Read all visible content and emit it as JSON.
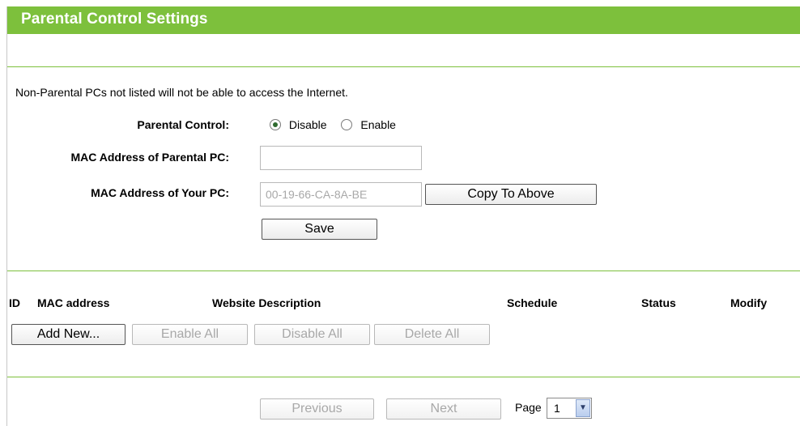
{
  "header": {
    "title": "Parental Control Settings"
  },
  "intro_text": "Non-Parental PCs not listed will not be able to access the Internet.",
  "form": {
    "parental_control_label": "Parental Control:",
    "radio_disable_label": "Disable",
    "radio_enable_label": "Enable",
    "selected": "Disable",
    "mac_parental_label": "MAC Address of Parental PC:",
    "mac_parental_value": "",
    "mac_your_label": "MAC Address of Your PC:",
    "mac_your_value": "00-19-66-CA-8A-BE",
    "copy_button": "Copy To Above",
    "save_button": "Save"
  },
  "table": {
    "columns": [
      "ID",
      "MAC address",
      "Website Description",
      "Schedule",
      "Status",
      "Modify"
    ],
    "rows": []
  },
  "actions": {
    "add_new": "Add New...",
    "enable_all": "Enable All",
    "disable_all": "Disable All",
    "delete_all": "Delete All"
  },
  "pagination": {
    "previous": "Previous",
    "next": "Next",
    "page_label": "Page",
    "page_value": "1"
  },
  "colors": {
    "accent": "#7dc03c"
  }
}
